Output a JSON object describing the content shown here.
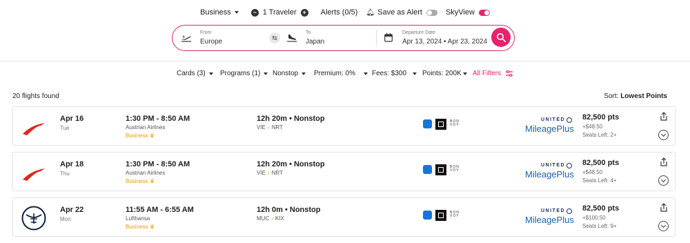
{
  "topbar": {
    "cabin": "Business",
    "travelers": "1 Traveler",
    "alerts": "Alerts (0/5)",
    "save_alert": "Save as Alert",
    "save_alert_on": false,
    "skyview": "SkyView",
    "skyview_on": true,
    "minus_symbol": "−",
    "plus_symbol": "+"
  },
  "search": {
    "from_label": "From",
    "from_value": "Europe",
    "to_label": "To",
    "to_value": "Japan",
    "date_label": "Departure Date",
    "date_value": "Apr 13, 2024 • Apr 23, 2024",
    "swap_symbol": "⇆"
  },
  "filters": {
    "cards": "Cards (3)",
    "programs": "Programs (1)",
    "stops": "Nonstop",
    "premium": "Premium: 0%",
    "fees": "Fees: $300",
    "points": "Points: 200K",
    "all_filters": "All Filters"
  },
  "results": {
    "count": "20 flights found",
    "sort_label": "Sort:",
    "sort_value": "Lowest Points"
  },
  "flights": [
    {
      "date": "Apr 16",
      "dow": "Tue",
      "time": "1:30 PM - 8:50 AM",
      "airline": "Austrian Airlines",
      "cabin": "Business",
      "duration": "12h 20m • Nonstop",
      "origin": "VIE",
      "dest": "NRT",
      "program_top": "UNITED",
      "program_name": "MileagePlus",
      "points": "82,500 pts",
      "fee": "+$48.50",
      "seats": "Seats Left: 2+",
      "logo": "austrian-logo"
    },
    {
      "date": "Apr 18",
      "dow": "Thu",
      "time": "1:30 PM - 8:50 AM",
      "airline": "Austrian Airlines",
      "cabin": "Business",
      "duration": "12h 20m • Nonstop",
      "origin": "VIE",
      "dest": "NRT",
      "program_top": "UNITED",
      "program_name": "MileagePlus",
      "points": "82,500 pts",
      "fee": "+$48.50",
      "seats": "Seats Left: 4+",
      "logo": "austrian-logo"
    },
    {
      "date": "Apr 22",
      "dow": "Mon",
      "time": "11:55 AM - 6:55 AM",
      "airline": "Lufthansa",
      "cabin": "Business",
      "duration": "12h 0m • Nonstop",
      "origin": "MUC",
      "dest": "KIX",
      "program_top": "UNITED",
      "program_name": "MileagePlus",
      "points": "82,500 pts",
      "fee": "+$100.50",
      "seats": "Seats Left: 9+",
      "logo": "lufthansa-logo"
    }
  ],
  "card_brands": {
    "bonvoy": "BON VOY"
  },
  "colors": {
    "accent": "#e8226b",
    "cabin": "#e89b00",
    "united_navy": "#1b2f6b",
    "united_blue": "#1b5fb0"
  }
}
